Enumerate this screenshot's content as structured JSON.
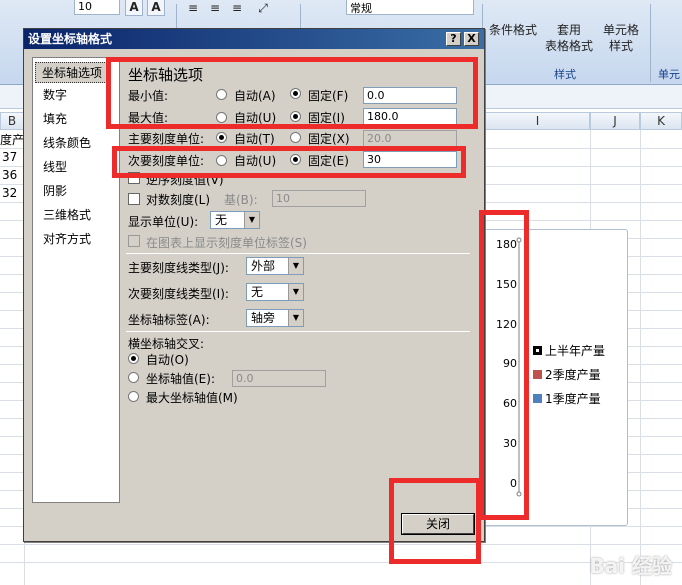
{
  "ribbon": {
    "font_size": "10",
    "number_format": "常规",
    "cond_format": "条件格式",
    "table_format_1": "套用",
    "table_format_2": "表格格式",
    "cell_style_1": "单元格",
    "cell_style_2": "样式",
    "group_styles": "样式",
    "group_cells": "单元"
  },
  "sheet": {
    "col_b": "B",
    "col_i": "I",
    "col_j": "J",
    "col_k": "K",
    "cell_b1": "度产",
    "cell_b2": "37",
    "cell_b3": "36",
    "cell_b4": "32"
  },
  "chart": {
    "ticks": [
      "180",
      "150",
      "120",
      "90",
      "60",
      "30",
      "0"
    ],
    "legend": [
      {
        "label": "上半年产量",
        "color": "#000000"
      },
      {
        "label": "2季度产量",
        "color": "#c0504d"
      },
      {
        "label": "1季度产量",
        "color": "#4f81bd"
      }
    ]
  },
  "dialog": {
    "title": "设置坐标轴格式",
    "help_label": "?",
    "close_label": "X",
    "nav": [
      "坐标轴选项",
      "数字",
      "填充",
      "线条颜色",
      "线型",
      "阴影",
      "三维格式",
      "对齐方式"
    ],
    "panel_title": "坐标轴选项",
    "min_label": "最小值:",
    "max_label": "最大值:",
    "major_unit_label": "主要刻度单位:",
    "minor_unit_label": "次要刻度单位:",
    "auto_a": "自动(A)",
    "auto_u": "自动(U)",
    "auto_t": "自动(T)",
    "fixed_f": "固定(F)",
    "fixed_i": "固定(I)",
    "fixed_x": "固定(X)",
    "fixed_e": "固定(E)",
    "min_value": "0.0",
    "max_value": "180.0",
    "major_value": "20.0",
    "minor_value": "30",
    "reverse_label": "逆序刻度值(V)",
    "log_label": "对数刻度(L)",
    "base_label": "基(B):",
    "base_value": "10",
    "display_unit_label": "显示单位(U):",
    "display_unit_value": "无",
    "show_unit_label": "在图表上显示刻度单位标签(S)",
    "major_tick_type_label": "主要刻度线类型(J):",
    "major_tick_type_value": "外部",
    "minor_tick_type_label": "次要刻度线类型(I):",
    "minor_tick_type_value": "无",
    "axis_label_label": "坐标轴标签(A):",
    "axis_label_value": "轴旁",
    "cross_label": "横坐标轴交叉:",
    "cross_auto": "自动(O)",
    "cross_value_label": "坐标轴值(E):",
    "cross_value": "0.0",
    "cross_max": "最大坐标轴值(M)",
    "close_button": "关闭"
  },
  "watermark": "Bai 经验"
}
